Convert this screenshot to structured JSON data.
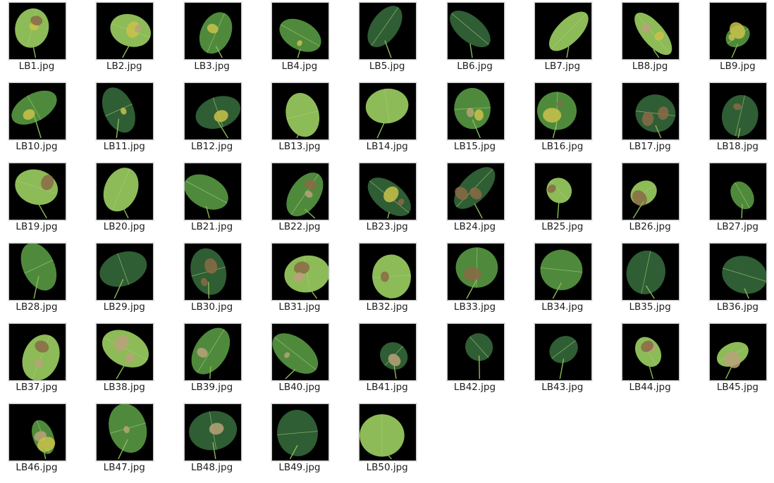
{
  "files": [
    {
      "name": "LB1.jpg",
      "icon": "leaf-thumbnail-icon"
    },
    {
      "name": "LB2.jpg",
      "icon": "leaf-thumbnail-icon"
    },
    {
      "name": "LB3.jpg",
      "icon": "leaf-thumbnail-icon"
    },
    {
      "name": "LB4.jpg",
      "icon": "leaf-thumbnail-icon"
    },
    {
      "name": "LB5.jpg",
      "icon": "leaf-thumbnail-icon"
    },
    {
      "name": "LB6.jpg",
      "icon": "leaf-thumbnail-icon"
    },
    {
      "name": "LB7.jpg",
      "icon": "leaf-thumbnail-icon"
    },
    {
      "name": "LB8.jpg",
      "icon": "leaf-thumbnail-icon"
    },
    {
      "name": "LB9.jpg",
      "icon": "leaf-thumbnail-icon"
    },
    {
      "name": "LB10.jpg",
      "icon": "leaf-thumbnail-icon"
    },
    {
      "name": "LB11.jpg",
      "icon": "leaf-thumbnail-icon"
    },
    {
      "name": "LB12.jpg",
      "icon": "leaf-thumbnail-icon"
    },
    {
      "name": "LB13.jpg",
      "icon": "leaf-thumbnail-icon"
    },
    {
      "name": "LB14.jpg",
      "icon": "leaf-thumbnail-icon"
    },
    {
      "name": "LB15.jpg",
      "icon": "leaf-thumbnail-icon"
    },
    {
      "name": "LB16.jpg",
      "icon": "leaf-thumbnail-icon"
    },
    {
      "name": "LB17.jpg",
      "icon": "leaf-thumbnail-icon"
    },
    {
      "name": "LB18.jpg",
      "icon": "leaf-thumbnail-icon"
    },
    {
      "name": "LB19.jpg",
      "icon": "leaf-thumbnail-icon"
    },
    {
      "name": "LB20.jpg",
      "icon": "leaf-thumbnail-icon"
    },
    {
      "name": "LB21.jpg",
      "icon": "leaf-thumbnail-icon"
    },
    {
      "name": "LB22.jpg",
      "icon": "leaf-thumbnail-icon"
    },
    {
      "name": "LB23.jpg",
      "icon": "leaf-thumbnail-icon"
    },
    {
      "name": "LB24.jpg",
      "icon": "leaf-thumbnail-icon"
    },
    {
      "name": "LB25.jpg",
      "icon": "leaf-thumbnail-icon"
    },
    {
      "name": "LB26.jpg",
      "icon": "leaf-thumbnail-icon"
    },
    {
      "name": "LB27.jpg",
      "icon": "leaf-thumbnail-icon"
    },
    {
      "name": "LB28.jpg",
      "icon": "leaf-thumbnail-icon"
    },
    {
      "name": "LB29.jpg",
      "icon": "leaf-thumbnail-icon"
    },
    {
      "name": "LB30.jpg",
      "icon": "leaf-thumbnail-icon"
    },
    {
      "name": "LB31.jpg",
      "icon": "leaf-thumbnail-icon"
    },
    {
      "name": "LB32.jpg",
      "icon": "leaf-thumbnail-icon"
    },
    {
      "name": "LB33.jpg",
      "icon": "leaf-thumbnail-icon"
    },
    {
      "name": "LB34.jpg",
      "icon": "leaf-thumbnail-icon"
    },
    {
      "name": "LB35.jpg",
      "icon": "leaf-thumbnail-icon"
    },
    {
      "name": "LB36.jpg",
      "icon": "leaf-thumbnail-icon"
    },
    {
      "name": "LB37.jpg",
      "icon": "leaf-thumbnail-icon"
    },
    {
      "name": "LB38.jpg",
      "icon": "leaf-thumbnail-icon"
    },
    {
      "name": "LB39.jpg",
      "icon": "leaf-thumbnail-icon"
    },
    {
      "name": "LB40.jpg",
      "icon": "leaf-thumbnail-icon"
    },
    {
      "name": "LB41.jpg",
      "icon": "leaf-thumbnail-icon"
    },
    {
      "name": "LB42.jpg",
      "icon": "leaf-thumbnail-icon"
    },
    {
      "name": "LB43.jpg",
      "icon": "leaf-thumbnail-icon"
    },
    {
      "name": "LB44.jpg",
      "icon": "leaf-thumbnail-icon"
    },
    {
      "name": "LB45.jpg",
      "icon": "leaf-thumbnail-icon"
    },
    {
      "name": "LB46.jpg",
      "icon": "leaf-thumbnail-icon"
    },
    {
      "name": "LB47.jpg",
      "icon": "leaf-thumbnail-icon"
    },
    {
      "name": "LB48.jpg",
      "icon": "leaf-thumbnail-icon"
    },
    {
      "name": "LB49.jpg",
      "icon": "leaf-thumbnail-icon"
    },
    {
      "name": "LB50.jpg",
      "icon": "leaf-thumbnail-icon"
    }
  ],
  "colors": {
    "thumbnail_background": "#000000",
    "leaf_healthy": "#4f8a3c",
    "leaf_light": "#8dbb57",
    "leaf_dark": "#2f5d34",
    "lesion_brown": "#8a6a45",
    "lesion_tan": "#b9a27a",
    "lesion_yellow": "#c9c24a",
    "label_text": "#1e1e1e"
  }
}
